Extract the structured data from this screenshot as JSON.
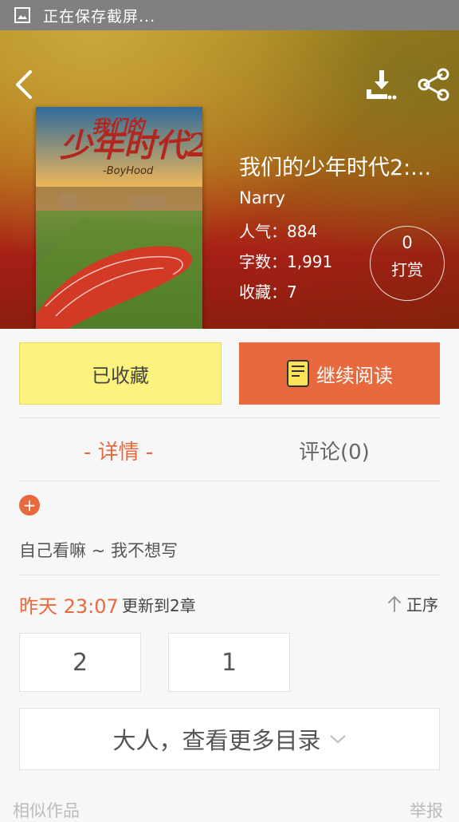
{
  "status_bar": {
    "text": "正在保存截屏..."
  },
  "book": {
    "title": "我们的少年时代2:...",
    "author": "Narry",
    "popularity": "人气：884",
    "word_count": "字数：1,991",
    "favorites": "收藏：7",
    "cover_title_text": "我们的少年时代2",
    "cover_subtitle_text": "-BoyHood"
  },
  "tip": {
    "count": "0",
    "label": "打赏"
  },
  "actions": {
    "favorited_label": "已收藏",
    "continue_label": "继续阅读"
  },
  "tabs": [
    {
      "label": "- 详情 -",
      "active": true
    },
    {
      "label": "评论(0)",
      "active": false
    }
  ],
  "description": "自己看嘛 ~ 我不想写",
  "update": {
    "time": "昨天 23:07",
    "info": "更新到2章",
    "sort_label": "正序"
  },
  "chapters": [
    "2",
    "1"
  ],
  "more_catalog": "大人，查看更多目录",
  "footer": {
    "similar": "相似作品",
    "report": "举报"
  },
  "colors": {
    "accent": "#e8693e",
    "favorite_bg": "#fdf27e"
  },
  "icons": [
    "image-icon",
    "back-icon",
    "download-icon",
    "share-icon",
    "book-icon",
    "plus-icon",
    "arrow-up-icon",
    "chevron-down-icon"
  ]
}
